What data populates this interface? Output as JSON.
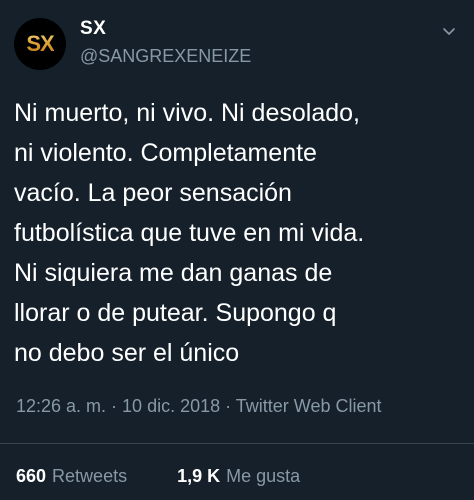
{
  "author": {
    "avatar_text": "SX",
    "display_name": "SX",
    "handle": "@SANGREXENEIZE"
  },
  "tweet": {
    "text": "Ni muerto, ni vivo. Ni desolado,\nni violento. Completamente\nvacío. La peor sensación\nfutbolística que tuve en mi vida.\nNi siquiera me dan ganas de\nllorar o de putear.  Supongo q\nno debo ser el único",
    "timestamp": "12:26 a. m. · 10 dic. 2018 · Twitter Web Client"
  },
  "stats": {
    "retweets_count": "660",
    "retweets_label": "Retweets",
    "likes_count": "1,9 K",
    "likes_label": "Me gusta"
  },
  "icons": {
    "menu": "chevron-down-icon"
  }
}
